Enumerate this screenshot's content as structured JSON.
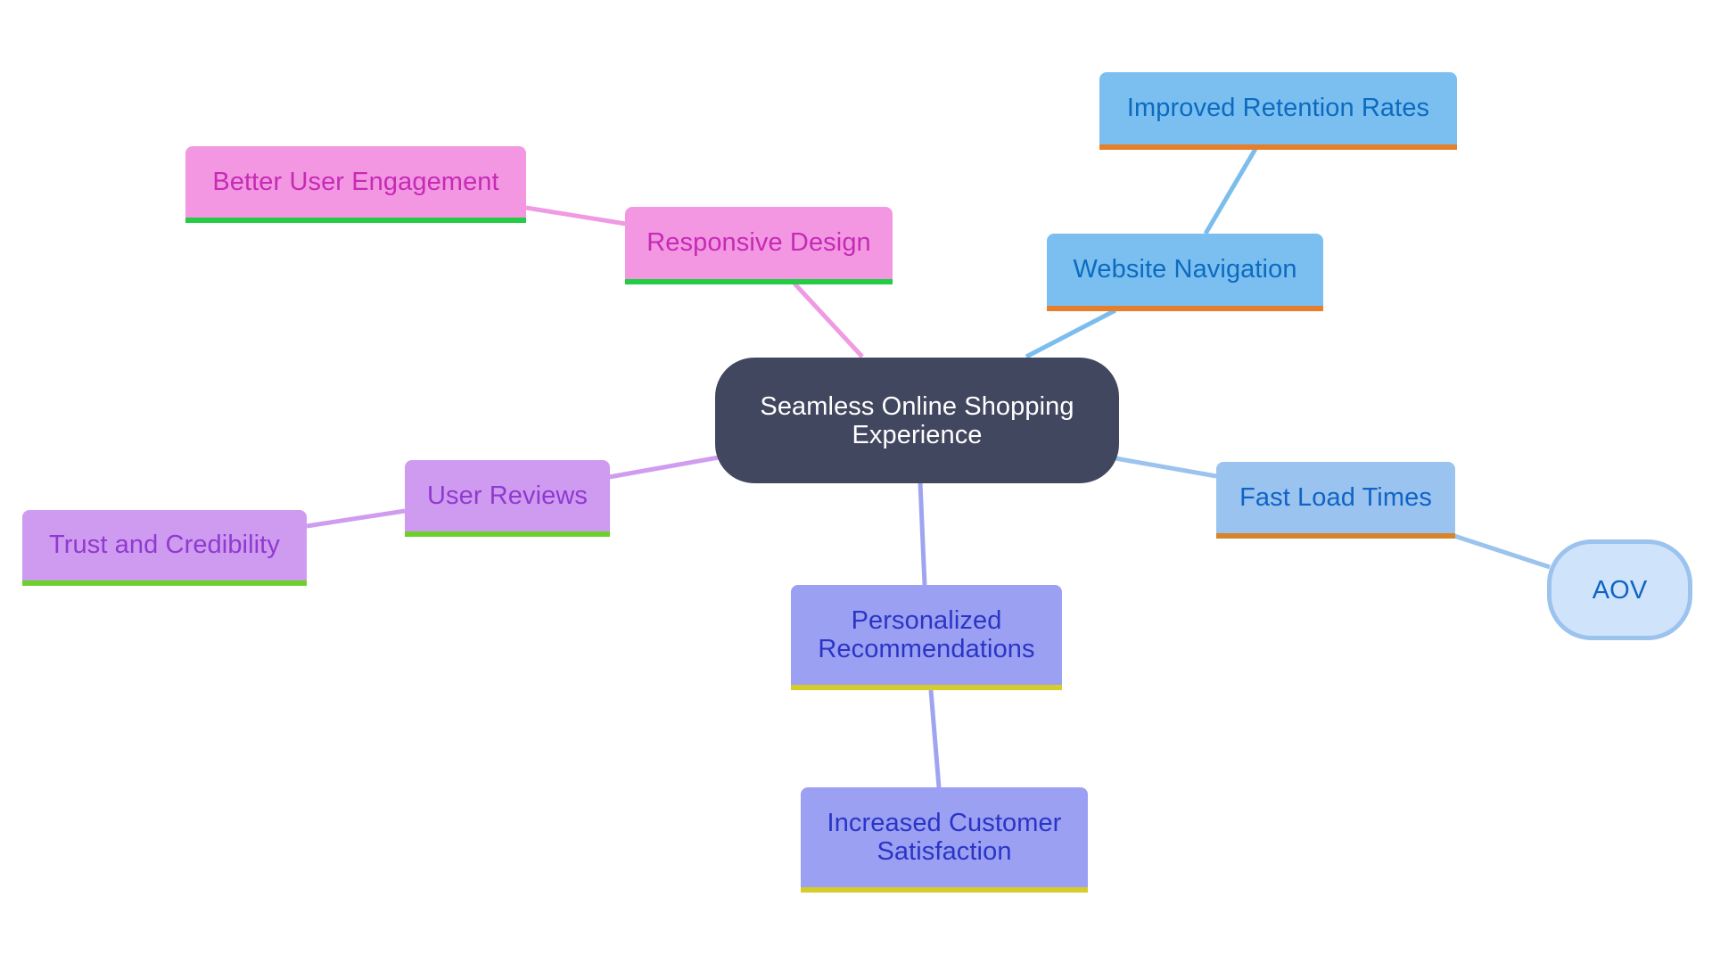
{
  "diagram": {
    "type": "mindmap",
    "root": {
      "id": "root",
      "label": "Seamless Online Shopping Experience",
      "bg": "#424760",
      "color": "#ffffff"
    },
    "nodes": [
      {
        "id": "responsive",
        "label": "Responsive Design",
        "parent": "root",
        "bg": "#f397e3",
        "color": "#c52bb4",
        "bar": "#22cc44",
        "edge": "#f09ae3"
      },
      {
        "id": "better",
        "label": "Better User Engagement",
        "parent": "responsive",
        "bg": "#f397e3",
        "color": "#c52bb4",
        "bar": "#22cc44",
        "edge": "#f09ae3"
      },
      {
        "id": "website",
        "label": "Website Navigation",
        "parent": "root",
        "bg": "#7bbff1",
        "color": "#0c6bbf",
        "bar": "#e57f2c",
        "edge": "#7bbdec"
      },
      {
        "id": "improved",
        "label": "Improved Retention Rates",
        "parent": "website",
        "bg": "#7bbff1",
        "color": "#0c6bbf",
        "bar": "#e57f2c",
        "edge": "#7bbdec"
      },
      {
        "id": "fast",
        "label": "Fast Load Times",
        "parent": "root",
        "bg": "#9bc3f0",
        "color": "#0f64c4",
        "bar": "#d6852a",
        "edge": "#9bc3ee"
      },
      {
        "id": "aov",
        "label": "AOV",
        "parent": "fast",
        "bg": "#cfe3fb",
        "color": "#0f64c4",
        "border": "#9bc3ee",
        "edge": "#9bc3ee"
      },
      {
        "id": "personalized",
        "label": "Personalized Recommendations",
        "parent": "root",
        "bg": "#9ba0f2",
        "color": "#2a35c6",
        "bar": "#d6cc2a",
        "edge": "#a0a4f0"
      },
      {
        "id": "increased",
        "label": "Increased Customer Satisfaction",
        "parent": "personalized",
        "bg": "#9ba0f2",
        "color": "#2a35c6",
        "bar": "#d6cc2a",
        "edge": "#a0a4f0"
      },
      {
        "id": "reviews",
        "label": "User Reviews",
        "parent": "root",
        "bg": "#cf9bf0",
        "color": "#8f3ad0",
        "bar": "#6ed12b",
        "edge": "#d09cef"
      },
      {
        "id": "trust",
        "label": "Trust and Credibility",
        "parent": "reviews",
        "bg": "#cf9bf0",
        "color": "#8f3ad0",
        "bar": "#6ed12b",
        "edge": "#d09cef"
      }
    ]
  }
}
